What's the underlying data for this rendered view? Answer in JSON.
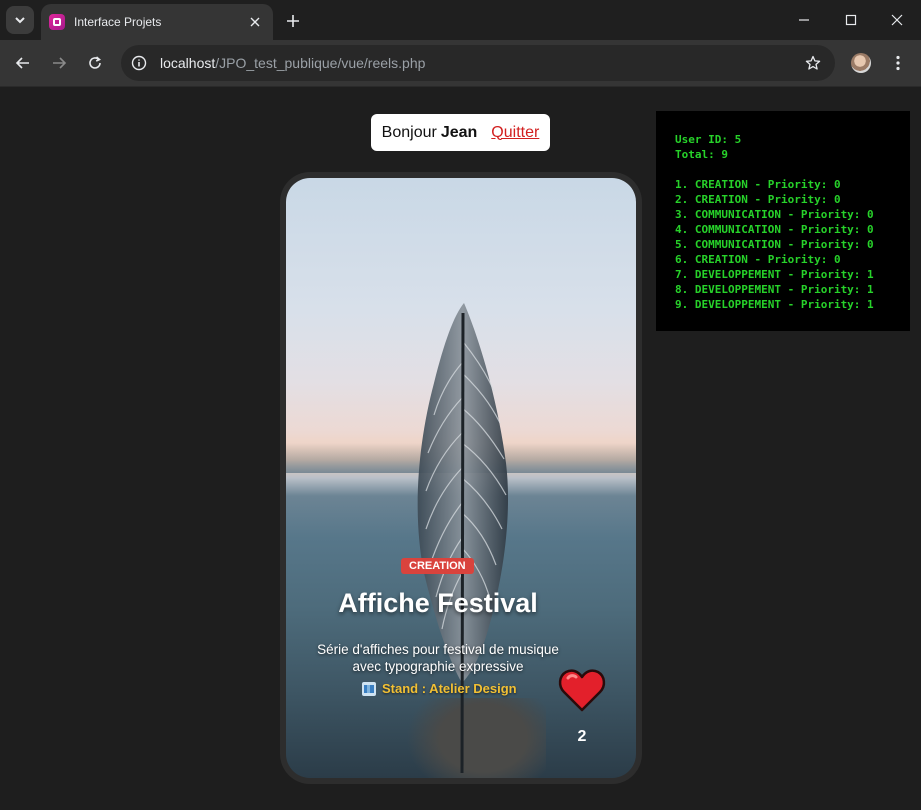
{
  "browser": {
    "tab_title": "Interface Projets",
    "url_host": "localhost",
    "url_path": "/JPO_test_publique/vue/reels.php"
  },
  "header": {
    "greeting": "Bonjour",
    "user_name": "Jean",
    "quit_label": "Quitter"
  },
  "debug": {
    "user_id_line": "User ID: 5",
    "total_line": "Total: 9",
    "items": [
      "1. CREATION - Priority: 0",
      "2. CREATION - Priority: 0",
      "3. COMMUNICATION - Priority: 0",
      "4. COMMUNICATION - Priority: 0",
      "5. COMMUNICATION - Priority: 0",
      "6. CREATION - Priority: 0",
      "7. DEVELOPPEMENT - Priority: 1",
      "8. DEVELOPPEMENT - Priority: 1",
      "9. DEVELOPPEMENT - Priority: 1"
    ]
  },
  "reel": {
    "category": "CREATION",
    "title": "Affiche Festival",
    "description_line1": "Série d'affiches pour festival de musique",
    "description_line2": "avec typographie expressive",
    "stand": "Stand : Atelier Design",
    "likes": "2",
    "icons": [
      "feather-photo",
      "stand-icon",
      "heart-icon"
    ]
  },
  "colors": {
    "category_badge": "#d9433d",
    "stand_text": "#f2c034",
    "debug_text": "#27d22a",
    "quit_link": "#d21f1f",
    "heart": "#e3202b"
  }
}
